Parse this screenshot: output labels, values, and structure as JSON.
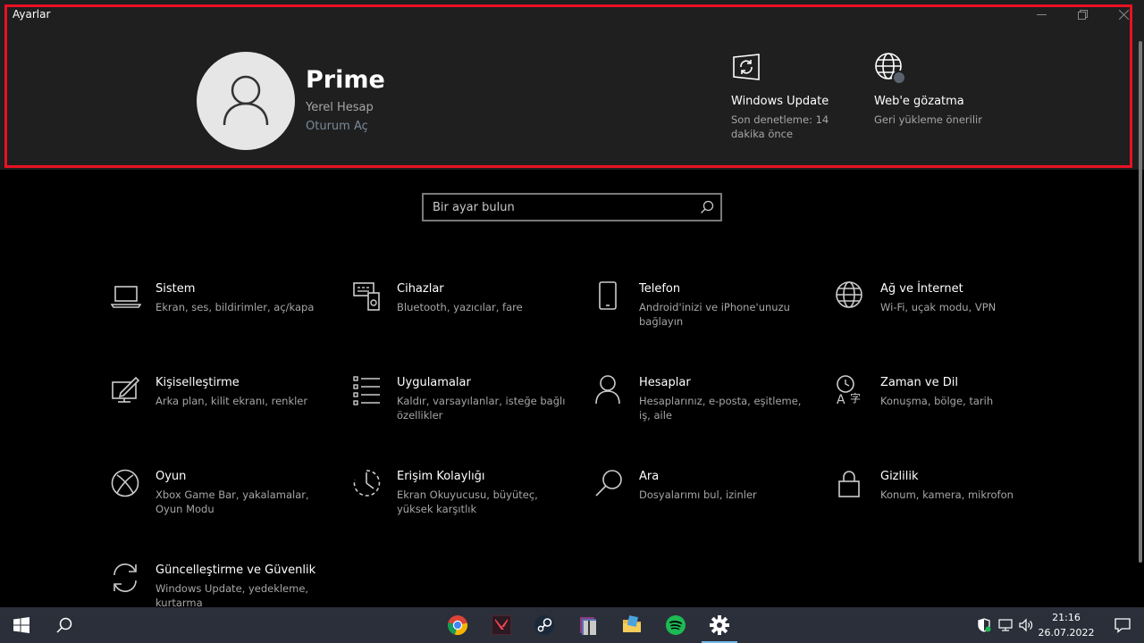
{
  "window": {
    "title": "Ayarlar"
  },
  "profile": {
    "name": "Prime",
    "account_type": "Yerel Hesap",
    "sign_in": "Oturum Aç"
  },
  "tiles": [
    {
      "title": "Windows Update",
      "subtitle": "Son denetleme: 14 dakika önce",
      "icon": "sync-icon"
    },
    {
      "title": "Web'e gözatma",
      "subtitle": "Geri yükleme önerilir",
      "icon": "globe-icon"
    }
  ],
  "search": {
    "placeholder": "Bir ayar bulun"
  },
  "categories": [
    {
      "title": "Sistem",
      "subtitle": "Ekran, ses, bildirimler, aç/kapa",
      "icon": "laptop-icon"
    },
    {
      "title": "Cihazlar",
      "subtitle": "Bluetooth, yazıcılar, fare",
      "icon": "devices-icon"
    },
    {
      "title": "Telefon",
      "subtitle": "Android'inizi ve iPhone'unuzu bağlayın",
      "icon": "phone-icon"
    },
    {
      "title": "Ağ ve İnternet",
      "subtitle": "Wi-Fi, uçak modu, VPN",
      "icon": "globe-icon"
    },
    {
      "title": "Kişiselleştirme",
      "subtitle": "Arka plan, kilit ekranı, renkler",
      "icon": "paint-icon"
    },
    {
      "title": "Uygulamalar",
      "subtitle": "Kaldır, varsayılanlar, isteğe bağlı özellikler",
      "icon": "apps-list-icon"
    },
    {
      "title": "Hesaplar",
      "subtitle": "Hesaplarınız, e-posta, eşitleme, iş, aile",
      "icon": "person-icon"
    },
    {
      "title": "Zaman ve Dil",
      "subtitle": "Konuşma, bölge, tarih",
      "icon": "time-language-icon"
    },
    {
      "title": "Oyun",
      "subtitle": "Xbox Game Bar, yakalamalar, Oyun Modu",
      "icon": "xbox-icon"
    },
    {
      "title": "Erişim Kolaylığı",
      "subtitle": "Ekran Okuyucusu, büyüteç, yüksek karşıtlık",
      "icon": "ease-of-access-icon"
    },
    {
      "title": "Ara",
      "subtitle": "Dosyalarımı bul, izinler",
      "icon": "search-icon"
    },
    {
      "title": "Gizlilik",
      "subtitle": "Konum, kamera, mikrofon",
      "icon": "lock-icon"
    },
    {
      "title": "Güncelleştirme ve Güvenlik",
      "subtitle": "Windows Update, yedekleme, kurtarma",
      "icon": "update-icon"
    }
  ],
  "taskbar": {
    "apps": [
      "chrome-icon",
      "valorant-icon",
      "steam-icon",
      "winrar-icon",
      "explorer-icon",
      "spotify-icon",
      "settings-gear-icon"
    ],
    "time": "21:16",
    "date": "26.07.2022"
  },
  "colors": {
    "highlight": "#e81123",
    "accent": "#76b9ed",
    "spotify": "#1db954"
  }
}
